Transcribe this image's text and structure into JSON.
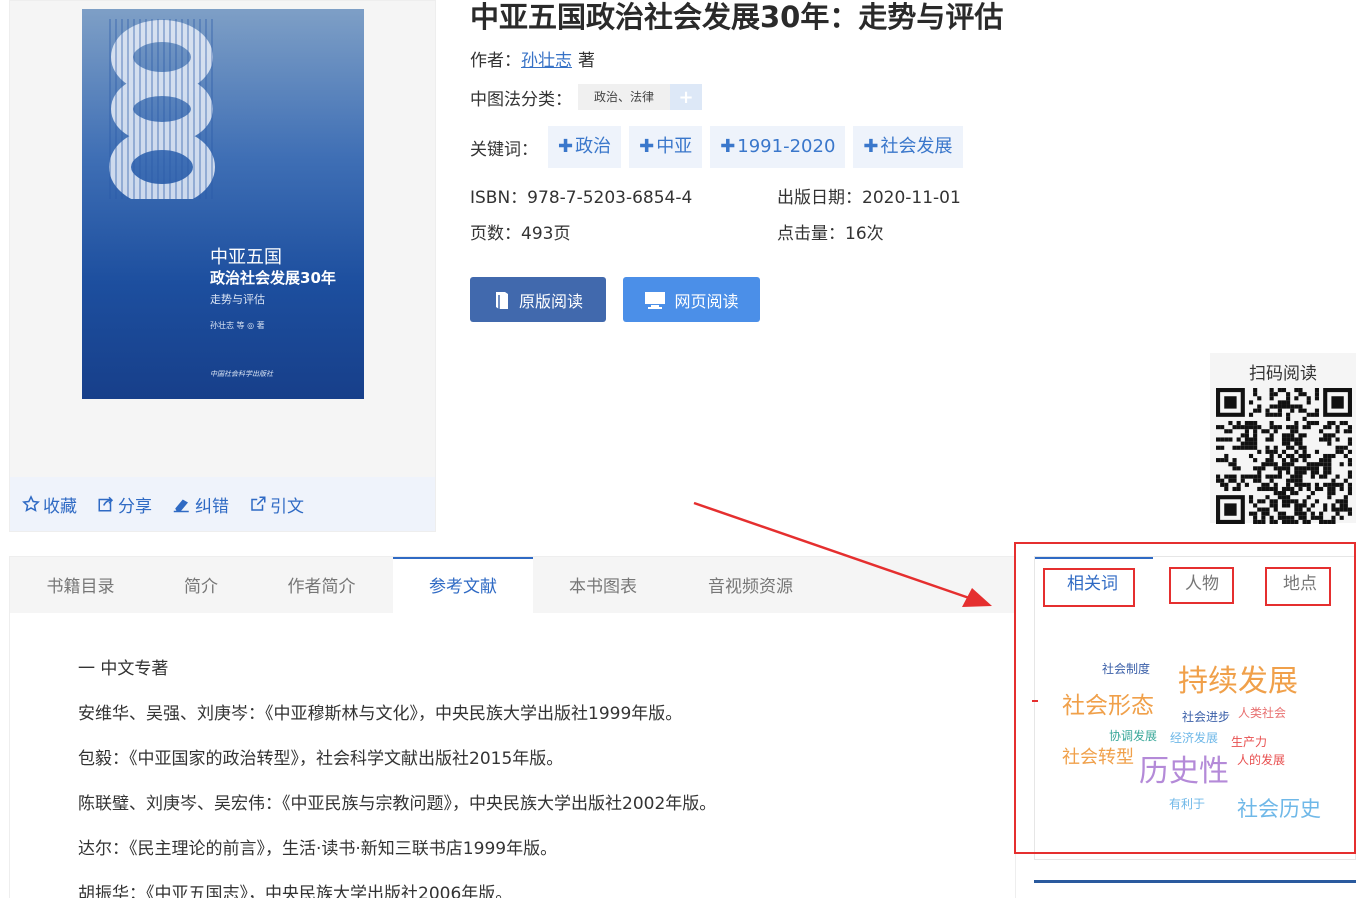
{
  "cover": {
    "big_number": "30",
    "title_line1": "中亚五国",
    "title_line2": "政治社会发展30年",
    "title_line3": "走势与评估",
    "author_line": "孙壮志 等 ◎ 著",
    "publisher_line": "中国社会科学出版社"
  },
  "actions": [
    {
      "label": "收藏",
      "icon": "star-icon"
    },
    {
      "label": "分享",
      "icon": "share-icon"
    },
    {
      "label": "纠错",
      "icon": "eraser-icon"
    },
    {
      "label": "引文",
      "icon": "external-link-icon"
    }
  ],
  "book": {
    "title": "中亚五国政治社会发展30年：走势与评估",
    "author_label": "作者：",
    "author_name": "孙壮志",
    "author_suffix": "著",
    "class_label": "中图法分类：",
    "class_value": "政治、法律",
    "class_plus": "+",
    "keywords_label": "关键词：",
    "keywords": [
      "政治",
      "中亚",
      "1991-2020",
      "社会发展"
    ],
    "isbn": "ISBN：978-7-5203-6854-4",
    "pub_date": "出版日期：2020-11-01",
    "pages": "页数：493页",
    "clicks": "点击量：16次"
  },
  "buttons": {
    "original": "原版阅读",
    "web": "网页阅读"
  },
  "qr": {
    "label": "扫码阅读"
  },
  "tabs": [
    "书籍目录",
    "简介",
    "作者简介",
    "参考文献",
    "本书图表",
    "音视频资源"
  ],
  "active_tab": "参考文献",
  "references": [
    "一 中文专著",
    "安维华、吴强、刘庚岑：《中亚穆斯林与文化》，中央民族大学出版社1999年版。",
    "包毅：《中亚国家的政治转型》，社会科学文献出版社2015年版。",
    "陈联璧、刘庚岑、吴宏伟：《中亚民族与宗教问题》，中央民族大学出版社2002年版。",
    "达尔：《民主理论的前言》，生活·读书·新知三联书店1999年版。",
    "胡振华：《中亚五国志》，中央民族大学出版社2006年版。"
  ],
  "side_tabs": [
    "相关词",
    "人物",
    "地点"
  ],
  "word_cloud": [
    {
      "text": "社会制度",
      "color": "#3a5fa8"
    },
    {
      "text": "持续发展",
      "color": "#f0a04a"
    },
    {
      "text": "社会形态",
      "color": "#f0a04a"
    },
    {
      "text": "社会进步",
      "color": "#3a5fa8"
    },
    {
      "text": "人类社会",
      "color": "#e87070"
    },
    {
      "text": "协调发展",
      "color": "#3aa89a"
    },
    {
      "text": "经济发展",
      "color": "#6fb8e8"
    },
    {
      "text": "生产力",
      "color": "#e85050"
    },
    {
      "text": "社会转型",
      "color": "#f0a04a"
    },
    {
      "text": "历史性",
      "color": "#b48ad8"
    },
    {
      "text": "人的发展",
      "color": "#e85050"
    },
    {
      "text": "有利于",
      "color": "#6fb8e8"
    },
    {
      "text": "社会历史",
      "color": "#6fb8e8"
    }
  ],
  "colors": {
    "accent": "#2f6ac4",
    "highlight": "#e52f2f"
  }
}
